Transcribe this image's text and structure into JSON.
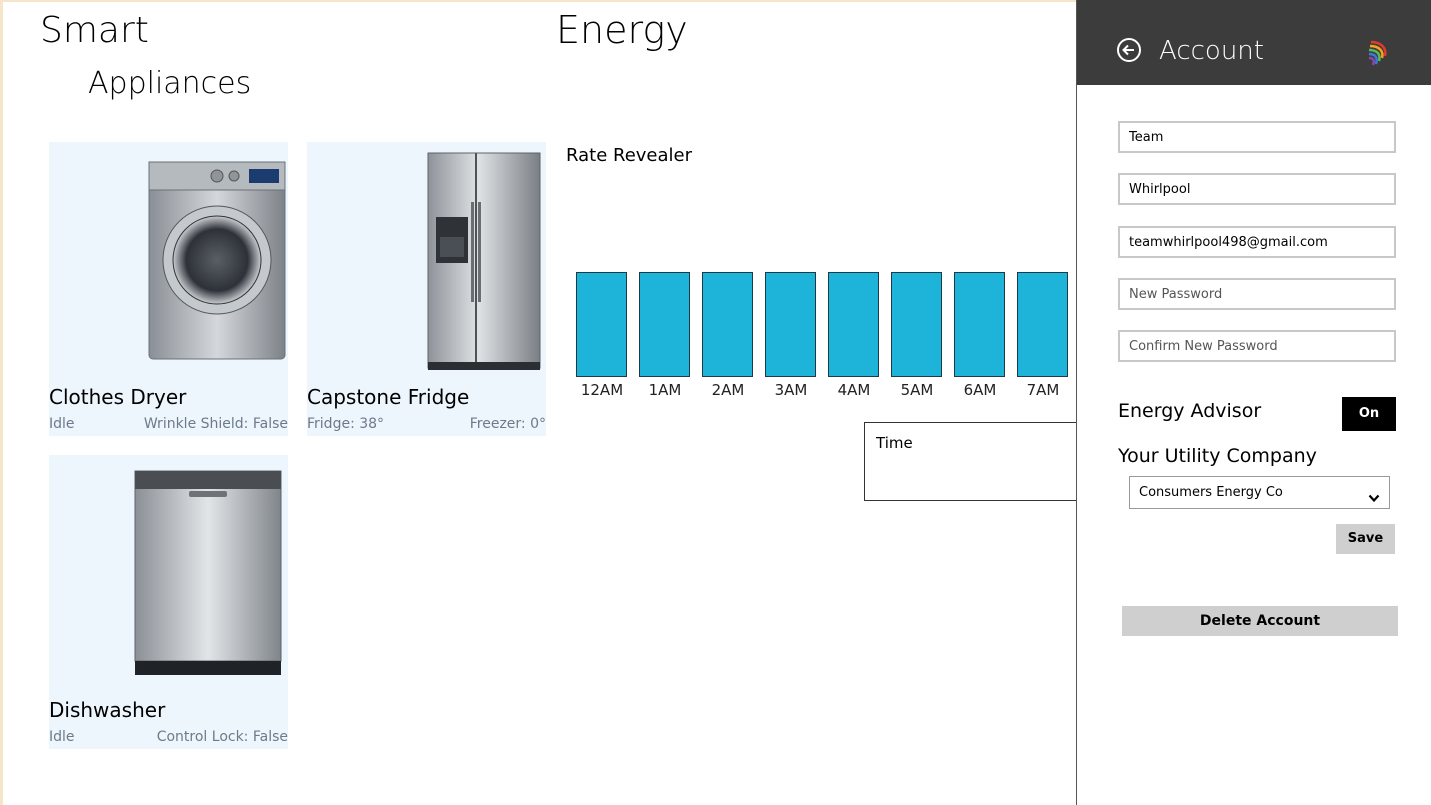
{
  "header": {
    "smart": "Smart",
    "appliances": "Appliances",
    "energy": "Energy"
  },
  "appliances": [
    {
      "name": "Clothes Dryer",
      "status_left": "Idle",
      "status_right": "Wrinkle Shield: False",
      "image": "washer-dryer-image"
    },
    {
      "name": "Capstone Fridge",
      "status_left": "Fridge: 38°",
      "status_right": "Freezer: 0°",
      "image": "fridge-image"
    },
    {
      "name": "Dishwasher",
      "status_left": "Idle",
      "status_right": "Control Lock: False",
      "image": "dishwasher-image"
    }
  ],
  "energy": {
    "rate_label": "Rate Revealer",
    "hours": [
      "12AM",
      "1AM",
      "2AM",
      "3AM",
      "4AM",
      "5AM",
      "6AM",
      "7AM"
    ],
    "bar_color": "#1eb4d9",
    "time_label": "Time"
  },
  "account": {
    "title": "Account",
    "back_icon": "back-arrow-icon",
    "logo": "rainbow-swirl-logo",
    "first_name": "Team",
    "last_name": "Whirlpool",
    "email": "teamwhirlpool498@gmail.com",
    "new_password_placeholder": "New Password",
    "confirm_password_placeholder": "Confirm New Password",
    "advisor_label": "Energy Advisor",
    "advisor_toggle": "On",
    "utility_label": "Your Utility Company",
    "utility_selected": "Consumers Energy Co",
    "save_label": "Save",
    "delete_label": "Delete Account",
    "header_bg": "#3c3c3c"
  }
}
